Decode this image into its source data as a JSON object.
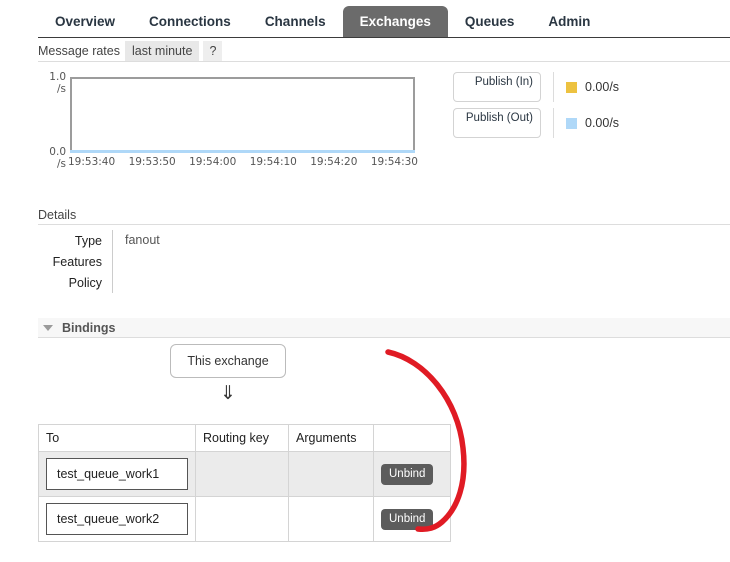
{
  "nav": {
    "tabs": [
      {
        "label": "Overview",
        "active": false
      },
      {
        "label": "Connections",
        "active": false
      },
      {
        "label": "Channels",
        "active": false
      },
      {
        "label": "Exchanges",
        "active": true
      },
      {
        "label": "Queues",
        "active": false
      },
      {
        "label": "Admin",
        "active": false
      }
    ]
  },
  "rates_bar": {
    "label": "Message rates",
    "selected_period": "last minute",
    "help": "?"
  },
  "chart_data": {
    "type": "line",
    "title": "Message rates",
    "xlabel": "",
    "ylabel": "/s",
    "ylim": [
      0.0,
      1.0
    ],
    "y_ticks": [
      "0.0 /s",
      "1.0 /s"
    ],
    "x_ticks": [
      "19:53:40",
      "19:53:50",
      "19:54:00",
      "19:54:10",
      "19:54:20",
      "19:54:30"
    ],
    "grid": false,
    "legend_position": "right",
    "series": [
      {
        "name": "Publish (In)",
        "color": "#edc240",
        "current_value": "0.00/s",
        "values": [
          0.0,
          0.0,
          0.0,
          0.0,
          0.0,
          0.0
        ]
      },
      {
        "name": "Publish (Out)",
        "color": "#afd8f8",
        "current_value": "0.00/s",
        "values": [
          0.0,
          0.0,
          0.0,
          0.0,
          0.0,
          0.0
        ]
      }
    ]
  },
  "details": {
    "heading": "Details",
    "rows": [
      {
        "key": "Type",
        "value": "fanout"
      },
      {
        "key": "Features",
        "value": ""
      },
      {
        "key": "Policy",
        "value": ""
      }
    ]
  },
  "bindings": {
    "heading": "Bindings",
    "exchange_box_label": "This exchange",
    "arrow_glyph": "⇓",
    "columns": [
      "To",
      "Routing key",
      "Arguments",
      ""
    ],
    "rows": [
      {
        "to": "test_queue_work1",
        "routing_key": "",
        "arguments": "",
        "action": "Unbind"
      },
      {
        "to": "test_queue_work2",
        "routing_key": "",
        "arguments": "",
        "action": "Unbind"
      }
    ]
  },
  "annotation": {
    "color": "#e01b24",
    "shape": "hand-drawn-bracket"
  }
}
